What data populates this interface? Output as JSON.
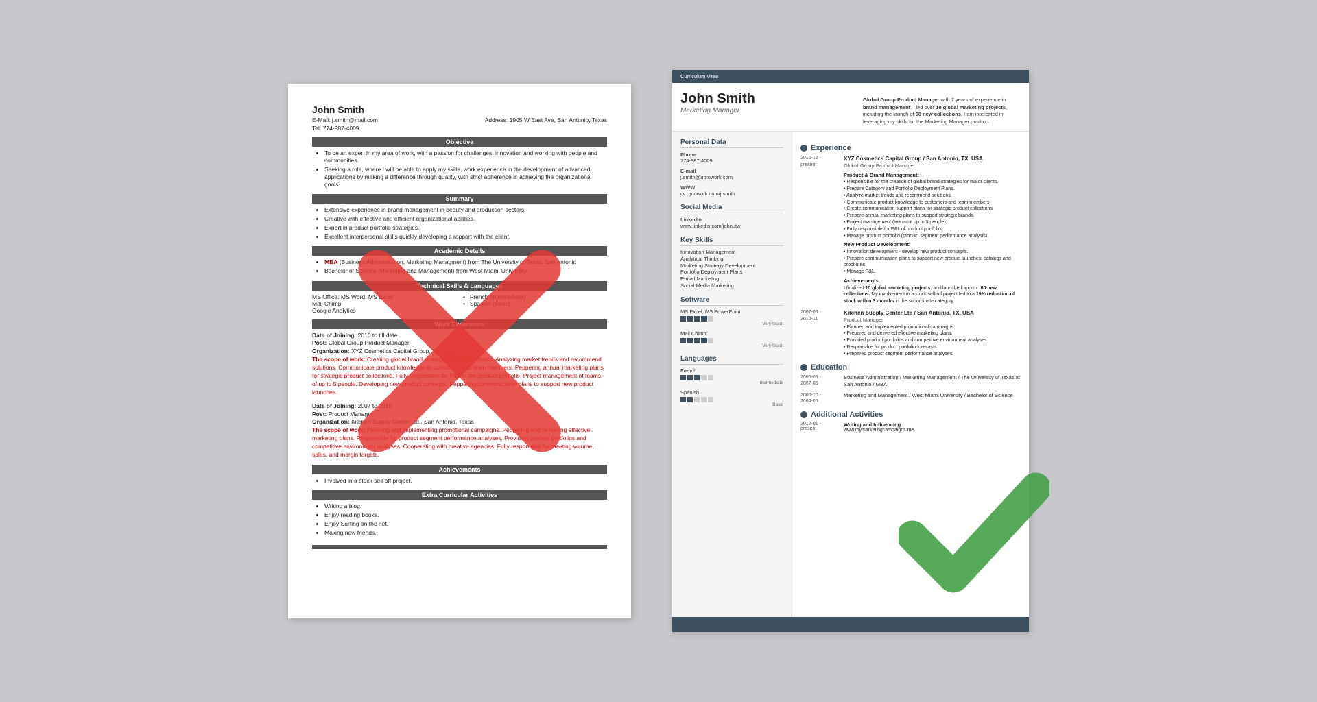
{
  "left_resume": {
    "name": "John Smith",
    "email": "E-Mail: j.smith@mail.com",
    "phone": "Tel: 774-987-4009",
    "address": "Address: 1905 W East Ave, San Antonio, Texas",
    "sections": {
      "objective": {
        "title": "Objective",
        "points": [
          "To be an expert in my area of work, with a passion for challenges, innovation and working with people and communities.",
          "Seeking a role, where I will be able to apply my skills, work experience in the development of advanced applications by making a difference through quality, with strict adherence in achieving the organizational goals."
        ]
      },
      "summary": {
        "title": "Summary",
        "points": [
          "Extensive experience in brand management in beauty and production sectors.",
          "Creative with effective and efficient organizational abilities.",
          "Expert in product portfolio strategies.",
          "Excellent interpersonal skills quickly developing a rapport with the client."
        ]
      },
      "academic": {
        "title": "Academic Details",
        "points": [
          "MBA (Business Administration, Marketing Managment) from The University of Texas, San Antonio",
          "Bachelor of Science (Marketing and Management) from West Miami University"
        ]
      },
      "technical": {
        "title": "Technical Skills & Languages",
        "col1": [
          "MS Office: MS Word, MS Excel",
          "Mail Chimp",
          "Google Analytics"
        ],
        "col2": [
          "French (intermediate)",
          "Spanish (basic)"
        ]
      },
      "work": {
        "title": "Work Experience",
        "entries": [
          {
            "joining": "Date of Joining: 2010 to till date",
            "post": "Post: Global Group Product Manager",
            "org": "Organization: XYZ Cosmetics Capital Group, San Antonio, TX",
            "scope": "The scope of work: Creating global brand strategies for major clients. Analyzing market trends and recommend solutions. Communicate product knowledge to customers and team members. Peppering annual marketing plans for strategic product collections. Fully responsible for P&L of the product portfolio. Project management of teams of up to 5 people. Developing new product concepts. Peppering communication plans to support new product launches."
          },
          {
            "joining": "Date of Joining: 2007 to 2010",
            "post": "Post: Product Manager",
            "org": "Organization: Kitchen Supply Center Ltd., San Antonio, Texas",
            "scope": "The scope of work: Planning and implementing promotional campaigns. Peppering and delivering effective marketing plans. Responsible for product segment performance analyses. Providing product portfolios and competitive environment analyses. Cooperating with creative agencies. Fully responsible for meeting volume, sales, and margin targets."
          }
        ]
      },
      "achievements": {
        "title": "Achievements",
        "points": [
          "Involved in a stock sell-off project."
        ]
      },
      "extra": {
        "title": "Extra Curricular Activities",
        "points": [
          "Writing a blog.",
          "Enjoy reading books.",
          "Enjoy Surfing on the net.",
          "Making new friends."
        ]
      }
    }
  },
  "right_resume": {
    "top_bar": "Curriculum Vitae",
    "name": "John Smith",
    "title": "Marketing Manager",
    "intro": "Global Group Product Manager with 7 years of experience in brand management. I led over 10 global marketing projects, including the launch of 60 new collections. I am interested in leveraging my skills for the Marketing Manager position.",
    "sidebar": {
      "personal_data": {
        "title": "Personal Data",
        "phone_label": "Phone",
        "phone": "774-987-4009",
        "email_label": "E-mail",
        "email": "j.smith@uptowork.com",
        "www_label": "WWW",
        "www": "cv.uptowork.com/j.smith"
      },
      "social_media": {
        "title": "Social Media",
        "linkedin_label": "LinkedIn",
        "linkedin": "www.linkedin.com/johnutw"
      },
      "key_skills": {
        "title": "Key Skills",
        "items": [
          "Innovation Management",
          "Analytical Thinking",
          "Marketing Strategy Development",
          "Portfolio Deployment Plans",
          "E-mail Marketing",
          "Social Media Marketing"
        ]
      },
      "software": {
        "title": "Software",
        "items": [
          {
            "name": "MS Excel, MS PowerPoint",
            "level": "Very Good",
            "filled": 4,
            "total": 5
          },
          {
            "name": "Mail Chimp",
            "level": "Very Good",
            "filled": 4,
            "total": 5
          }
        ]
      },
      "languages": {
        "title": "Languages",
        "items": [
          {
            "name": "French",
            "level": "Intermediate",
            "filled": 3,
            "total": 5
          },
          {
            "name": "Spanish",
            "level": "Basic",
            "filled": 2,
            "total": 5
          }
        ]
      }
    },
    "main": {
      "experience": {
        "title": "Experience",
        "entries": [
          {
            "date": "2010-12 - present",
            "company": "XYZ Cosmetics Capital Group / San Antonio, TX, USA",
            "role": "Global Group Product Manager",
            "sub_title1": "Product & Brand Management:",
            "bullets1": [
              "Responsible for the creation of global brand strategies for major clients.",
              "Prepare Category and Portfolio Deployment Plans.",
              "Analyze market trends and recommend solutions.",
              "Communicate product knowledge to customers and team members.",
              "Create communication support plans for strategic product collections.",
              "Prepare annual marketing plans to support strategic brands.",
              "Project management (teams of up to 5 people).",
              "Fully responsible for P&L of product portfolio.",
              "Manage product portfolio (product segment performance analysis)."
            ],
            "sub_title2": "New Product Development:",
            "bullets2": [
              "Innovation development - develop new product concepts.",
              "Prepare communication plans to support new product launches: catalogs and brochures.",
              "Manage P&L."
            ],
            "sub_title3": "Achievements:",
            "achievements": "I finalized 10 global marketing projects, and launched approx. 80 new collections. My involvement in a stock sell-off project led to a 19% reduction of stock within 3 months in the subordinate category."
          },
          {
            "date": "2007-09 - 2010-11",
            "company": "Kitchen Supply Center Ltd / San Antonio, TX, USA",
            "role": "Product Manager",
            "bullets1": [
              "Planned and implemented promotional campaigns.",
              "Prepared and delivered effective marketing plans.",
              "Provided product portfolios and competitive environment analyses.",
              "Responsible for product portfolio forecasts.",
              "Prepared product segment performance analyses."
            ]
          }
        ]
      },
      "education": {
        "title": "Education",
        "entries": [
          {
            "date": "2005-09 - 2007-05",
            "body": "Business Administration / Marketing Management / The University of Texas at San Antonio / MBA"
          },
          {
            "date": "2000-10 - 2004-05",
            "body": "Marketing and Management / West Miami University / Bachelor of Science"
          }
        ]
      },
      "additional": {
        "title": "Additional Activities",
        "entries": [
          {
            "date": "2012-01 - present",
            "title": "Writing and Influencing",
            "body": "www.mymarketingcampaigns.me"
          }
        ]
      }
    }
  }
}
